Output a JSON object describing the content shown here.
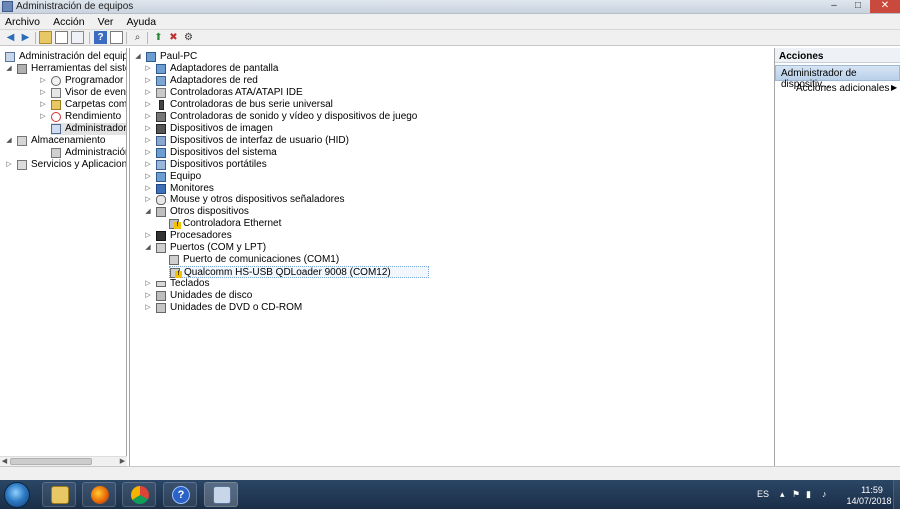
{
  "window": {
    "title": "Administración de equipos",
    "controls": {
      "minimize": "–",
      "maximize": "□",
      "close": "✕"
    }
  },
  "menu": [
    "Archivo",
    "Acción",
    "Ver",
    "Ayuda"
  ],
  "left_tree": [
    {
      "label": "Administración del equipo (loc",
      "icon": "computer-management-icon",
      "level": 0,
      "expander": ""
    },
    {
      "label": "Herramientas del sistema",
      "icon": "tools-icon",
      "level": 1,
      "expander": "◢"
    },
    {
      "label": "Programador de tareas",
      "icon": "clock-icon",
      "level": 2,
      "expander": "▷"
    },
    {
      "label": "Visor de eventos",
      "icon": "event-viewer-icon",
      "level": 2,
      "expander": "▷"
    },
    {
      "label": "Carpetas compartidas",
      "icon": "shared-folder-icon",
      "level": 2,
      "expander": "▷"
    },
    {
      "label": "Rendimiento",
      "icon": "performance-icon",
      "level": 2,
      "expander": "▷"
    },
    {
      "label": "Administrador de dispo",
      "icon": "device-manager-icon",
      "level": 2,
      "expander": "",
      "selected": true
    },
    {
      "label": "Almacenamiento",
      "icon": "storage-icon",
      "level": 1,
      "expander": "◢"
    },
    {
      "label": "Administración de disco",
      "icon": "disk-icon",
      "level": 2,
      "expander": ""
    },
    {
      "label": "Servicios y Aplicaciones",
      "icon": "services-icon",
      "level": 1,
      "expander": "▷"
    }
  ],
  "device_tree": {
    "root": "Paul-PC",
    "items": [
      {
        "label": "Adaptadores de pantalla",
        "icon": "display-adapter-icon",
        "level": 1,
        "expander": "▷"
      },
      {
        "label": "Adaptadores de red",
        "icon": "network-adapter-icon",
        "level": 1,
        "expander": "▷"
      },
      {
        "label": "Controladoras ATA/ATAPI IDE",
        "icon": "ide-controller-icon",
        "level": 1,
        "expander": "▷"
      },
      {
        "label": "Controladoras de bus serie universal",
        "icon": "usb-icon",
        "level": 1,
        "expander": "▷"
      },
      {
        "label": "Controladoras de sonido y vídeo y dispositivos de juego",
        "icon": "sound-icon",
        "level": 1,
        "expander": "▷"
      },
      {
        "label": "Dispositivos de imagen",
        "icon": "camera-icon",
        "level": 1,
        "expander": "▷"
      },
      {
        "label": "Dispositivos de interfaz de usuario (HID)",
        "icon": "hid-icon",
        "level": 1,
        "expander": "▷"
      },
      {
        "label": "Dispositivos del sistema",
        "icon": "system-devices-icon",
        "level": 1,
        "expander": "▷"
      },
      {
        "label": "Dispositivos portátiles",
        "icon": "portable-device-icon",
        "level": 1,
        "expander": "▷"
      },
      {
        "label": "Equipo",
        "icon": "computer-icon",
        "level": 1,
        "expander": "▷"
      },
      {
        "label": "Monitores",
        "icon": "monitor-icon",
        "level": 1,
        "expander": "▷"
      },
      {
        "label": "Mouse y otros dispositivos señaladores",
        "icon": "mouse-icon",
        "level": 1,
        "expander": "▷"
      },
      {
        "label": "Otros dispositivos",
        "icon": "other-devices-icon",
        "level": 1,
        "expander": "◢"
      },
      {
        "label": "Controladora Ethernet",
        "icon": "warning-device-icon",
        "level": 2,
        "expander": ""
      },
      {
        "label": "Procesadores",
        "icon": "processor-icon",
        "level": 1,
        "expander": "▷"
      },
      {
        "label": "Puertos (COM y LPT)",
        "icon": "port-icon",
        "level": 1,
        "expander": "◢"
      },
      {
        "label": "Puerto de comunicaciones (COM1)",
        "icon": "port-icon",
        "level": 2,
        "expander": ""
      },
      {
        "label": "Qualcomm HS-USB QDLoader 9008 (COM12)",
        "icon": "warning-port-icon",
        "level": 2,
        "expander": "",
        "selected": true
      },
      {
        "label": "Teclados",
        "icon": "keyboard-icon",
        "level": 1,
        "expander": "▷"
      },
      {
        "label": "Unidades de disco",
        "icon": "disk-drive-icon",
        "level": 1,
        "expander": "▷"
      },
      {
        "label": "Unidades de DVD o CD-ROM",
        "icon": "dvd-icon",
        "level": 1,
        "expander": "▷"
      }
    ]
  },
  "actions": {
    "header": "Acciones",
    "section": "Administrador de dispositiv...",
    "item": "Acciones adicionales"
  },
  "tray": {
    "language": "ES",
    "time": "11:59",
    "date": "14/07/2018"
  },
  "taskbar": [
    "file-explorer-icon",
    "firefox-icon",
    "chrome-icon",
    "help-icon",
    "computer-management-icon"
  ],
  "colors": {
    "selection": "#b9d0ea",
    "taskbar": "#1f3553"
  }
}
